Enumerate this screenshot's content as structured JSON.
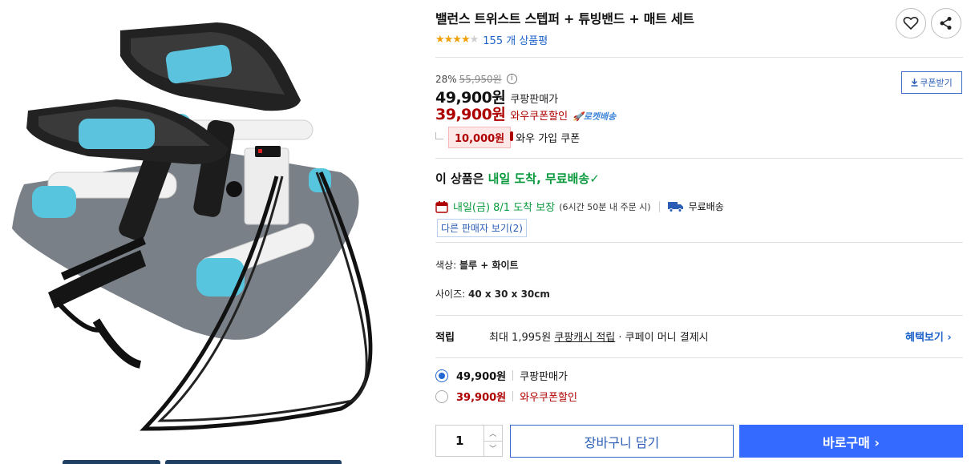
{
  "product": {
    "title": "밸런스 트위스트 스텝퍼 + 튜빙밴드 + 매트 세트",
    "rating_stars": "★★★★",
    "rating_empty_star": "★",
    "rating_value": 4,
    "review_count_text": "155 개 상품평"
  },
  "price": {
    "discount_rate": "28%",
    "original_price": "55,950원",
    "info_icon_symbol": "i",
    "sale_price": "49,900원",
    "sale_label": "쿠팡판매가",
    "wow_price": "39,900원",
    "wow_label": "와우쿠폰할인",
    "rocket_badge": "로켓배송",
    "coupon_button": "쿠폰받기",
    "coupon_amount": "10,000원",
    "coupon_text": "와우 가입 쿠폰"
  },
  "delivery": {
    "headline_prefix": "이 상품은 ",
    "headline_highlight": "내일 도착, 무료배송",
    "check_symbol": "✓",
    "date_text": "내일(금) 8/1 도착 보장",
    "date_note": "(6시간 50분 내 주문 시)",
    "free_shipping": "무료배송",
    "other_sellers": "다른 판매자 보기(2)"
  },
  "specs": {
    "color_label": "색상: ",
    "color_value": "블루 + 화이트",
    "size_label": "사이즈: ",
    "size_value": "40 x 30 x 30cm"
  },
  "points": {
    "label": "적립",
    "prefix": "최대 1,995원 ",
    "link": "쿠팡캐시 적립",
    "suffix": " · 쿠페이 머니 결제시",
    "benefit_link": "혜택보기 ›"
  },
  "options": [
    {
      "price": "49,900원",
      "label": "쿠팡판매가",
      "selected": true
    },
    {
      "price": "39,900원",
      "label": "와우쿠폰할인",
      "selected": false
    }
  ],
  "purchase": {
    "quantity": "1",
    "up_arrow": "︿",
    "down_arrow": "﹀",
    "cart_button": "장바구니 담기",
    "buy_button": "바로구매 ›"
  },
  "icons": [
    "heart-icon",
    "share-icon",
    "download-icon",
    "rocket-icon",
    "calendar-icon",
    "truck-icon"
  ],
  "colors": {
    "wow_red": "#ae0000",
    "link_blue": "#1d62c9",
    "buy_blue": "#346aff",
    "star_gold": "#f0a008",
    "delivery_green": "#0a9a3e",
    "mint": "#56c5dd"
  }
}
